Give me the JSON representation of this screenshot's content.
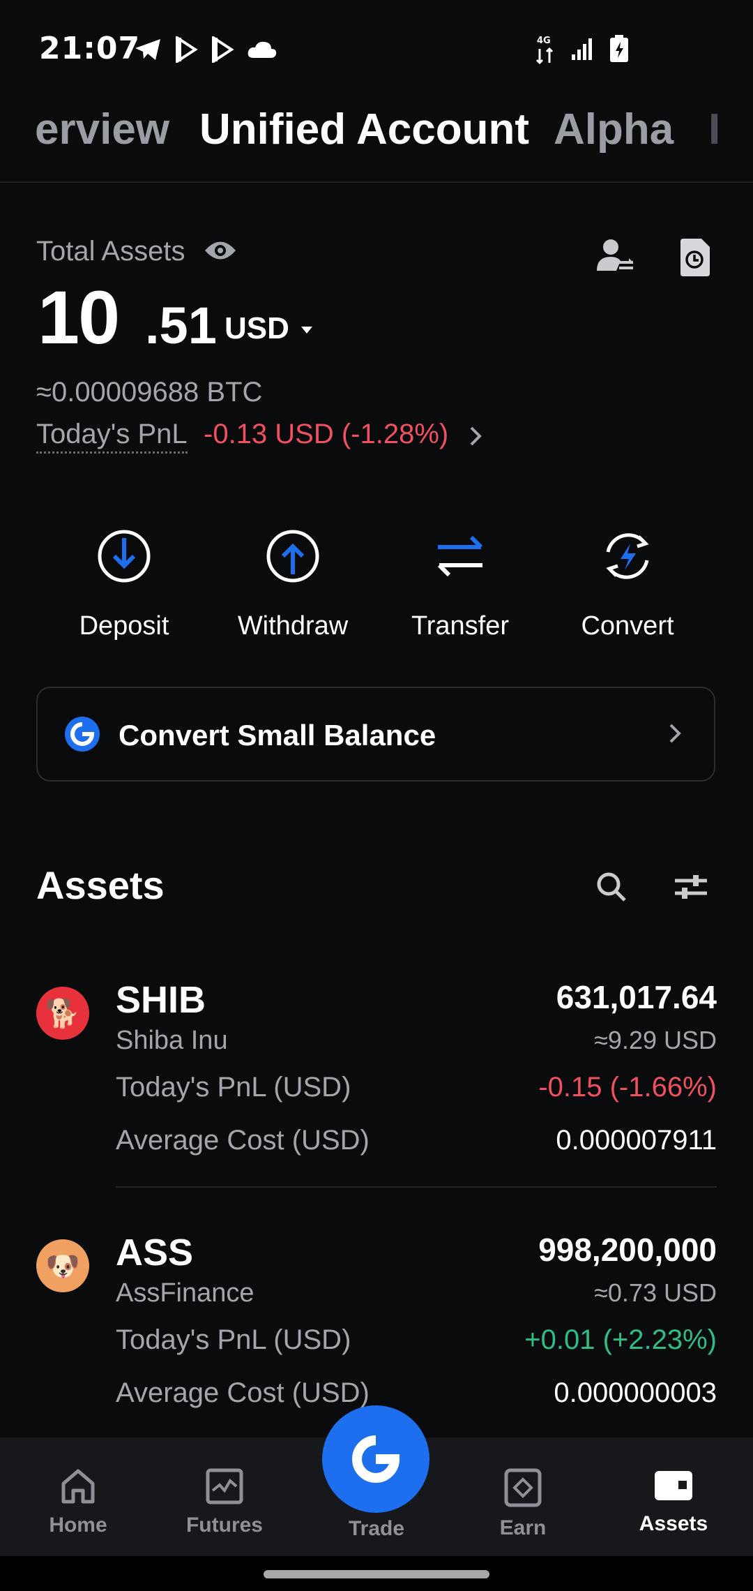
{
  "status": {
    "time": "21:07"
  },
  "tabs": [
    "erview",
    "Unified Account",
    "Alpha",
    "I"
  ],
  "total_assets": {
    "label": "Total Assets",
    "integer": "10",
    "decimal": ".51",
    "currency": "USD",
    "btc": "≈0.00009688 BTC",
    "pnl_label": "Today's PnL",
    "pnl_value": "-0.13 USD (-1.28%)"
  },
  "actions": [
    {
      "label": "Deposit"
    },
    {
      "label": "Withdraw"
    },
    {
      "label": "Transfer"
    },
    {
      "label": "Convert"
    }
  ],
  "convert_small_balance": {
    "label": "Convert Small Balance"
  },
  "assets": {
    "title": "Assets",
    "rows": [
      {
        "symbol": "SHIB",
        "name": "Shiba Inu",
        "amount": "631,017.64",
        "usd": "≈9.29 USD",
        "pnl_label": "Today's PnL (USD)",
        "pnl_value": "-0.15 (-1.66%)",
        "cost_label": "Average Cost (USD)",
        "cost_value": "0.000007911",
        "logo_color": "#e8323b",
        "logo_glyph": "🐕"
      },
      {
        "symbol": "ASS",
        "name": "AssFinance",
        "amount": "998,200,000",
        "usd": "≈0.73 USD",
        "pnl_label": "Today's PnL (USD)",
        "pnl_value": "+0.01 (+2.23%)",
        "cost_label": "Average Cost (USD)",
        "cost_value": "0.000000003",
        "logo_color": "#f0a060",
        "logo_glyph": "🐶"
      }
    ]
  },
  "nav": {
    "home": "Home",
    "futures": "Futures",
    "trade": "Trade",
    "earn": "Earn",
    "assets": "Assets"
  },
  "colors": {
    "accent": "#1d6ff0",
    "negative": "#f0505f",
    "positive": "#2ebd85",
    "background": "#0a0b0d"
  }
}
